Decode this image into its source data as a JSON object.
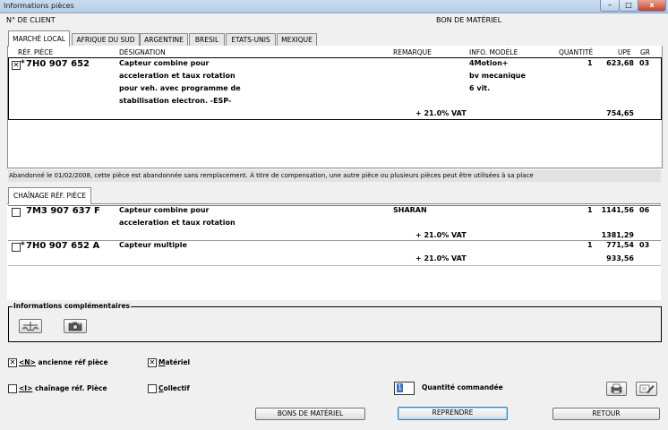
{
  "window": {
    "title": "Informations pièces",
    "minimize": "–",
    "maximize": "□",
    "close": "x"
  },
  "header": {
    "client_label": "N° DE CLIENT",
    "material_label": "BON DE MATÉRIEL"
  },
  "tabs": [
    {
      "label": "MARCHÉ LOCAL",
      "active": true
    },
    {
      "label": "AFRIQUE DU SUD",
      "active": false
    },
    {
      "label": "ARGENTINE",
      "active": false
    },
    {
      "label": "BRESIL",
      "active": false
    },
    {
      "label": "ETATS-UNIS",
      "active": false
    },
    {
      "label": "MEXIQUE",
      "active": false
    }
  ],
  "columns": {
    "ref": "RÉF. PIÈCE",
    "designation": "DÉSIGNATION",
    "remark": "REMARQUE",
    "model_info": "INFO. MODÈLE",
    "quantity": "QUANTITÉ",
    "upe": "UPE",
    "gr": "GR"
  },
  "main_part": {
    "checked": true,
    "mark": "*",
    "ref": "7H0 907 652",
    "designation_lines": [
      "Capteur combine pour",
      "acceleration et taux rotation",
      "pour veh. avec programme de",
      "stabilisation electron.  -ESP-"
    ],
    "remark": "",
    "model_lines": [
      "4Motion+",
      "bv mecanique",
      "6 vit."
    ],
    "quantity": "1",
    "upe": "623,68",
    "gr": "03",
    "vat_label": "+ 21.0% VAT",
    "vat_total": "754,65"
  },
  "notice": "Abandonné le 01/02/2008, cette pièce est abandonnée sans remplacement. À titre de compensation, une autre pièce ou plusieurs pièces peut être utilisées à sa place",
  "chain_tab": "CHAÎNAGE RÉF. PIÈCE",
  "chain_parts": [
    {
      "checked": false,
      "mark": "",
      "ref": "7M3 907 637 F",
      "designation_lines": [
        "Capteur combine pour",
        "acceleration et taux rotation"
      ],
      "remark": "SHARAN",
      "quantity": "1",
      "upe": "1141,56",
      "gr": "06",
      "vat_label": "+ 21.0% VAT",
      "vat_total": "1381,29"
    },
    {
      "checked": false,
      "mark": "*",
      "ref": "7H0 907 652 A",
      "designation_lines": [
        "Capteur multiple"
      ],
      "remark": "",
      "quantity": "1",
      "upe": "771,54",
      "gr": "03",
      "vat_label": "+ 21.0% VAT",
      "vat_total": "933,56"
    }
  ],
  "info_comp": {
    "legend": "Informations complémentaires"
  },
  "options": {
    "old_ref_prefix": "<N>",
    "old_ref_rest": " ancienne réf pièce",
    "old_ref_checked": true,
    "materiel_first": "M",
    "materiel_rest": "atériel",
    "materiel_checked": true,
    "chain_prefix": "<I>",
    "chain_rest": " chaînage réf. Pièce",
    "chain_checked": false,
    "collectif_first": "C",
    "collectif_rest": "ollectif",
    "collectif_checked": false
  },
  "quantity": {
    "value": "1",
    "label": "Quantité commandée"
  },
  "buttons": {
    "bons_materiel": "BONS DE MATÉRIEL",
    "reprendre": "REPRENDRE",
    "retour": "RETOUR"
  }
}
